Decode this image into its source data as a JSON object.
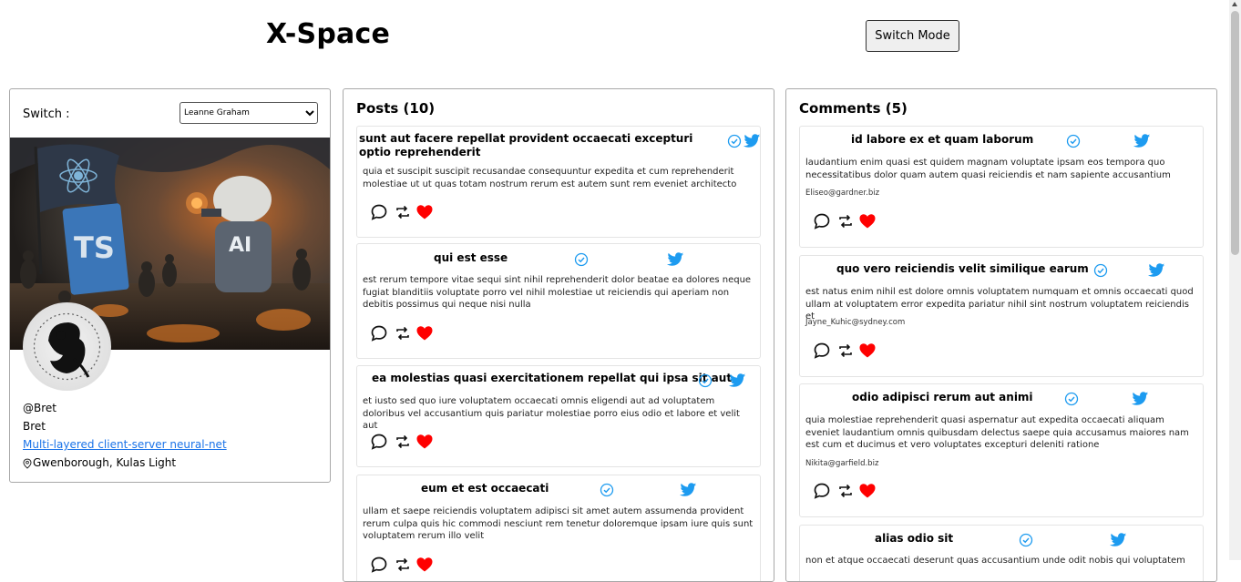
{
  "app": {
    "title": "X-Space",
    "switch_mode_label": "Switch Mode"
  },
  "profile": {
    "switch_label": "Switch :",
    "selected_user": "Leanne Graham",
    "handle": "@Bret",
    "username": "Bret",
    "catch_phrase": "Multi-layered client-server neural-net",
    "location": "Gwenborough, Kulas Light",
    "banner_letters": [
      "TS",
      "AI"
    ]
  },
  "posts": {
    "heading": "Posts (10)",
    "items": [
      {
        "title": "sunt aut facere repellat provident occaecati excepturi optio reprehenderit",
        "body": "quia et suscipit suscipit recusandae consequuntur expedita et cum reprehenderit molestiae ut ut quas totam nostrum rerum est autem sunt rem eveniet architecto"
      },
      {
        "title": "qui est esse",
        "body": "est rerum tempore vitae sequi sint nihil reprehenderit dolor beatae ea dolores neque fugiat blanditiis voluptate porro vel nihil molestiae ut reiciendis qui aperiam non debitis possimus qui neque nisi nulla"
      },
      {
        "title": "ea molestias quasi exercitationem repellat qui ipsa sit aut",
        "body": "et iusto sed quo iure voluptatem occaecati omnis eligendi aut ad voluptatem doloribus vel accusantium quis pariatur molestiae porro eius odio et labore et velit aut"
      },
      {
        "title": "eum et est occaecati",
        "body": "ullam et saepe reiciendis voluptatem adipisci sit amet autem assumenda provident rerum culpa quis hic commodi nesciunt rem tenetur doloremque ipsam iure quis sunt voluptatem rerum illo velit"
      }
    ]
  },
  "comments": {
    "heading": "Comments (5)",
    "items": [
      {
        "title": "id labore ex et quam laborum",
        "body": "laudantium enim quasi est quidem magnam voluptate ipsam eos tempora quo necessitatibus dolor quam autem quasi reiciendis et nam sapiente accusantium",
        "email": "Eliseo@gardner.biz"
      },
      {
        "title": "quo vero reiciendis velit similique earum",
        "body": "est natus enim nihil est dolore omnis voluptatem numquam et omnis occaecati quod ullam at voluptatem error expedita pariatur nihil sint nostrum voluptatem reiciendis et",
        "email": "Jayne_Kuhic@sydney.com"
      },
      {
        "title": "odio adipisci rerum aut animi",
        "body": "quia molestiae reprehenderit quasi aspernatur aut expedita occaecati aliquam eveniet laudantium omnis quibusdam delectus saepe quia accusamus maiores nam est cum et ducimus et vero voluptates excepturi deleniti ratione",
        "email": "Nikita@garfield.biz"
      },
      {
        "title": "alias odio sit",
        "body": "non et atque occaecati deserunt quas accusantium unde odit nobis qui voluptatem",
        "email": ""
      }
    ]
  },
  "icons": {
    "verified": "verified-badge-icon",
    "twitter": "twitter-bird-icon",
    "comment": "comment-bubble-icon",
    "retweet": "retweet-icon",
    "like": "heart-icon",
    "location": "location-pin-icon"
  },
  "colors": {
    "accent_blue": "#1d9bf0",
    "link_blue": "#1a73e8",
    "heart_red": "#ff0000",
    "border": "#a8a8a8"
  }
}
